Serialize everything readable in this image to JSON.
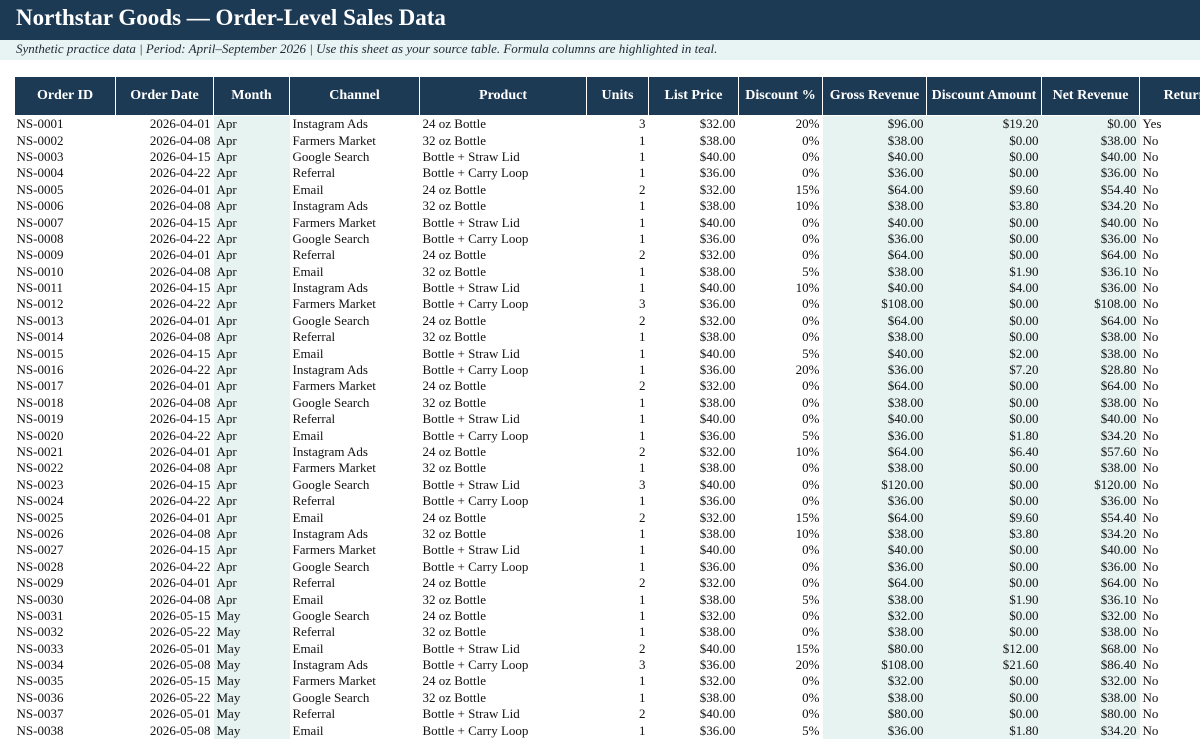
{
  "title": "Northstar Goods — Order-Level Sales Data",
  "subtitle": "Synthetic practice data | Period: April–September 2026 | Use this sheet as your source table. Formula columns are highlighted in teal.",
  "columns": [
    {
      "key": "id",
      "label": "Order ID",
      "width": 101,
      "align": "left",
      "teal": false
    },
    {
      "key": "date",
      "label": "Order Date",
      "width": 98,
      "align": "right",
      "teal": false
    },
    {
      "key": "month",
      "label": "Month",
      "width": 76,
      "align": "left",
      "teal": true
    },
    {
      "key": "channel",
      "label": "Channel",
      "width": 130,
      "align": "left",
      "teal": false
    },
    {
      "key": "product",
      "label": "Product",
      "width": 167,
      "align": "left",
      "teal": false
    },
    {
      "key": "units",
      "label": "Units",
      "width": 62,
      "align": "right",
      "teal": false
    },
    {
      "key": "price",
      "label": "List Price",
      "width": 90,
      "align": "right",
      "teal": false
    },
    {
      "key": "disc",
      "label": "Discount %",
      "width": 84,
      "align": "right",
      "teal": false
    },
    {
      "key": "gross",
      "label": "Gross Revenue",
      "width": 104,
      "align": "right",
      "teal": true
    },
    {
      "key": "discamt",
      "label": "Discount Amount",
      "width": 115,
      "align": "right",
      "teal": true
    },
    {
      "key": "net",
      "label": "Net Revenue",
      "width": 98,
      "align": "right",
      "teal": true
    },
    {
      "key": "ret",
      "label": "Returned",
      "width": 105,
      "align": "left",
      "teal": false
    }
  ],
  "rows": [
    [
      "NS-0001",
      "2026-04-01",
      "Apr",
      "Instagram Ads",
      "24 oz Bottle",
      "3",
      "$32.00",
      "20%",
      "$96.00",
      "$19.20",
      "$0.00",
      "Yes"
    ],
    [
      "NS-0002",
      "2026-04-08",
      "Apr",
      "Farmers Market",
      "32 oz Bottle",
      "1",
      "$38.00",
      "0%",
      "$38.00",
      "$0.00",
      "$38.00",
      "No"
    ],
    [
      "NS-0003",
      "2026-04-15",
      "Apr",
      "Google Search",
      "Bottle + Straw Lid",
      "1",
      "$40.00",
      "0%",
      "$40.00",
      "$0.00",
      "$40.00",
      "No"
    ],
    [
      "NS-0004",
      "2026-04-22",
      "Apr",
      "Referral",
      "Bottle + Carry Loop",
      "1",
      "$36.00",
      "0%",
      "$36.00",
      "$0.00",
      "$36.00",
      "No"
    ],
    [
      "NS-0005",
      "2026-04-01",
      "Apr",
      "Email",
      "24 oz Bottle",
      "2",
      "$32.00",
      "15%",
      "$64.00",
      "$9.60",
      "$54.40",
      "No"
    ],
    [
      "NS-0006",
      "2026-04-08",
      "Apr",
      "Instagram Ads",
      "32 oz Bottle",
      "1",
      "$38.00",
      "10%",
      "$38.00",
      "$3.80",
      "$34.20",
      "No"
    ],
    [
      "NS-0007",
      "2026-04-15",
      "Apr",
      "Farmers Market",
      "Bottle + Straw Lid",
      "1",
      "$40.00",
      "0%",
      "$40.00",
      "$0.00",
      "$40.00",
      "No"
    ],
    [
      "NS-0008",
      "2026-04-22",
      "Apr",
      "Google Search",
      "Bottle + Carry Loop",
      "1",
      "$36.00",
      "0%",
      "$36.00",
      "$0.00",
      "$36.00",
      "No"
    ],
    [
      "NS-0009",
      "2026-04-01",
      "Apr",
      "Referral",
      "24 oz Bottle",
      "2",
      "$32.00",
      "0%",
      "$64.00",
      "$0.00",
      "$64.00",
      "No"
    ],
    [
      "NS-0010",
      "2026-04-08",
      "Apr",
      "Email",
      "32 oz Bottle",
      "1",
      "$38.00",
      "5%",
      "$38.00",
      "$1.90",
      "$36.10",
      "No"
    ],
    [
      "NS-0011",
      "2026-04-15",
      "Apr",
      "Instagram Ads",
      "Bottle + Straw Lid",
      "1",
      "$40.00",
      "10%",
      "$40.00",
      "$4.00",
      "$36.00",
      "No"
    ],
    [
      "NS-0012",
      "2026-04-22",
      "Apr",
      "Farmers Market",
      "Bottle + Carry Loop",
      "3",
      "$36.00",
      "0%",
      "$108.00",
      "$0.00",
      "$108.00",
      "No"
    ],
    [
      "NS-0013",
      "2026-04-01",
      "Apr",
      "Google Search",
      "24 oz Bottle",
      "2",
      "$32.00",
      "0%",
      "$64.00",
      "$0.00",
      "$64.00",
      "No"
    ],
    [
      "NS-0014",
      "2026-04-08",
      "Apr",
      "Referral",
      "32 oz Bottle",
      "1",
      "$38.00",
      "0%",
      "$38.00",
      "$0.00",
      "$38.00",
      "No"
    ],
    [
      "NS-0015",
      "2026-04-15",
      "Apr",
      "Email",
      "Bottle + Straw Lid",
      "1",
      "$40.00",
      "5%",
      "$40.00",
      "$2.00",
      "$38.00",
      "No"
    ],
    [
      "NS-0016",
      "2026-04-22",
      "Apr",
      "Instagram Ads",
      "Bottle + Carry Loop",
      "1",
      "$36.00",
      "20%",
      "$36.00",
      "$7.20",
      "$28.80",
      "No"
    ],
    [
      "NS-0017",
      "2026-04-01",
      "Apr",
      "Farmers Market",
      "24 oz Bottle",
      "2",
      "$32.00",
      "0%",
      "$64.00",
      "$0.00",
      "$64.00",
      "No"
    ],
    [
      "NS-0018",
      "2026-04-08",
      "Apr",
      "Google Search",
      "32 oz Bottle",
      "1",
      "$38.00",
      "0%",
      "$38.00",
      "$0.00",
      "$38.00",
      "No"
    ],
    [
      "NS-0019",
      "2026-04-15",
      "Apr",
      "Referral",
      "Bottle + Straw Lid",
      "1",
      "$40.00",
      "0%",
      "$40.00",
      "$0.00",
      "$40.00",
      "No"
    ],
    [
      "NS-0020",
      "2026-04-22",
      "Apr",
      "Email",
      "Bottle + Carry Loop",
      "1",
      "$36.00",
      "5%",
      "$36.00",
      "$1.80",
      "$34.20",
      "No"
    ],
    [
      "NS-0021",
      "2026-04-01",
      "Apr",
      "Instagram Ads",
      "24 oz Bottle",
      "2",
      "$32.00",
      "10%",
      "$64.00",
      "$6.40",
      "$57.60",
      "No"
    ],
    [
      "NS-0022",
      "2026-04-08",
      "Apr",
      "Farmers Market",
      "32 oz Bottle",
      "1",
      "$38.00",
      "0%",
      "$38.00",
      "$0.00",
      "$38.00",
      "No"
    ],
    [
      "NS-0023",
      "2026-04-15",
      "Apr",
      "Google Search",
      "Bottle + Straw Lid",
      "3",
      "$40.00",
      "0%",
      "$120.00",
      "$0.00",
      "$120.00",
      "No"
    ],
    [
      "NS-0024",
      "2026-04-22",
      "Apr",
      "Referral",
      "Bottle + Carry Loop",
      "1",
      "$36.00",
      "0%",
      "$36.00",
      "$0.00",
      "$36.00",
      "No"
    ],
    [
      "NS-0025",
      "2026-04-01",
      "Apr",
      "Email",
      "24 oz Bottle",
      "2",
      "$32.00",
      "15%",
      "$64.00",
      "$9.60",
      "$54.40",
      "No"
    ],
    [
      "NS-0026",
      "2026-04-08",
      "Apr",
      "Instagram Ads",
      "32 oz Bottle",
      "1",
      "$38.00",
      "10%",
      "$38.00",
      "$3.80",
      "$34.20",
      "No"
    ],
    [
      "NS-0027",
      "2026-04-15",
      "Apr",
      "Farmers Market",
      "Bottle + Straw Lid",
      "1",
      "$40.00",
      "0%",
      "$40.00",
      "$0.00",
      "$40.00",
      "No"
    ],
    [
      "NS-0028",
      "2026-04-22",
      "Apr",
      "Google Search",
      "Bottle + Carry Loop",
      "1",
      "$36.00",
      "0%",
      "$36.00",
      "$0.00",
      "$36.00",
      "No"
    ],
    [
      "NS-0029",
      "2026-04-01",
      "Apr",
      "Referral",
      "24 oz Bottle",
      "2",
      "$32.00",
      "0%",
      "$64.00",
      "$0.00",
      "$64.00",
      "No"
    ],
    [
      "NS-0030",
      "2026-04-08",
      "Apr",
      "Email",
      "32 oz Bottle",
      "1",
      "$38.00",
      "5%",
      "$38.00",
      "$1.90",
      "$36.10",
      "No"
    ],
    [
      "NS-0031",
      "2026-05-15",
      "May",
      "Google Search",
      "24 oz Bottle",
      "1",
      "$32.00",
      "0%",
      "$32.00",
      "$0.00",
      "$32.00",
      "No"
    ],
    [
      "NS-0032",
      "2026-05-22",
      "May",
      "Referral",
      "32 oz Bottle",
      "1",
      "$38.00",
      "0%",
      "$38.00",
      "$0.00",
      "$38.00",
      "No"
    ],
    [
      "NS-0033",
      "2026-05-01",
      "May",
      "Email",
      "Bottle + Straw Lid",
      "2",
      "$40.00",
      "15%",
      "$80.00",
      "$12.00",
      "$68.00",
      "No"
    ],
    [
      "NS-0034",
      "2026-05-08",
      "May",
      "Instagram Ads",
      "Bottle + Carry Loop",
      "3",
      "$36.00",
      "20%",
      "$108.00",
      "$21.60",
      "$86.40",
      "No"
    ],
    [
      "NS-0035",
      "2026-05-15",
      "May",
      "Farmers Market",
      "24 oz Bottle",
      "1",
      "$32.00",
      "0%",
      "$32.00",
      "$0.00",
      "$32.00",
      "No"
    ],
    [
      "NS-0036",
      "2026-05-22",
      "May",
      "Google Search",
      "32 oz Bottle",
      "1",
      "$38.00",
      "0%",
      "$38.00",
      "$0.00",
      "$38.00",
      "No"
    ],
    [
      "NS-0037",
      "2026-05-01",
      "May",
      "Referral",
      "Bottle + Straw Lid",
      "2",
      "$40.00",
      "0%",
      "$80.00",
      "$0.00",
      "$80.00",
      "No"
    ],
    [
      "NS-0038",
      "2026-05-08",
      "May",
      "Email",
      "Bottle + Carry Loop",
      "1",
      "$36.00",
      "5%",
      "$36.00",
      "$1.80",
      "$34.20",
      "No"
    ]
  ]
}
